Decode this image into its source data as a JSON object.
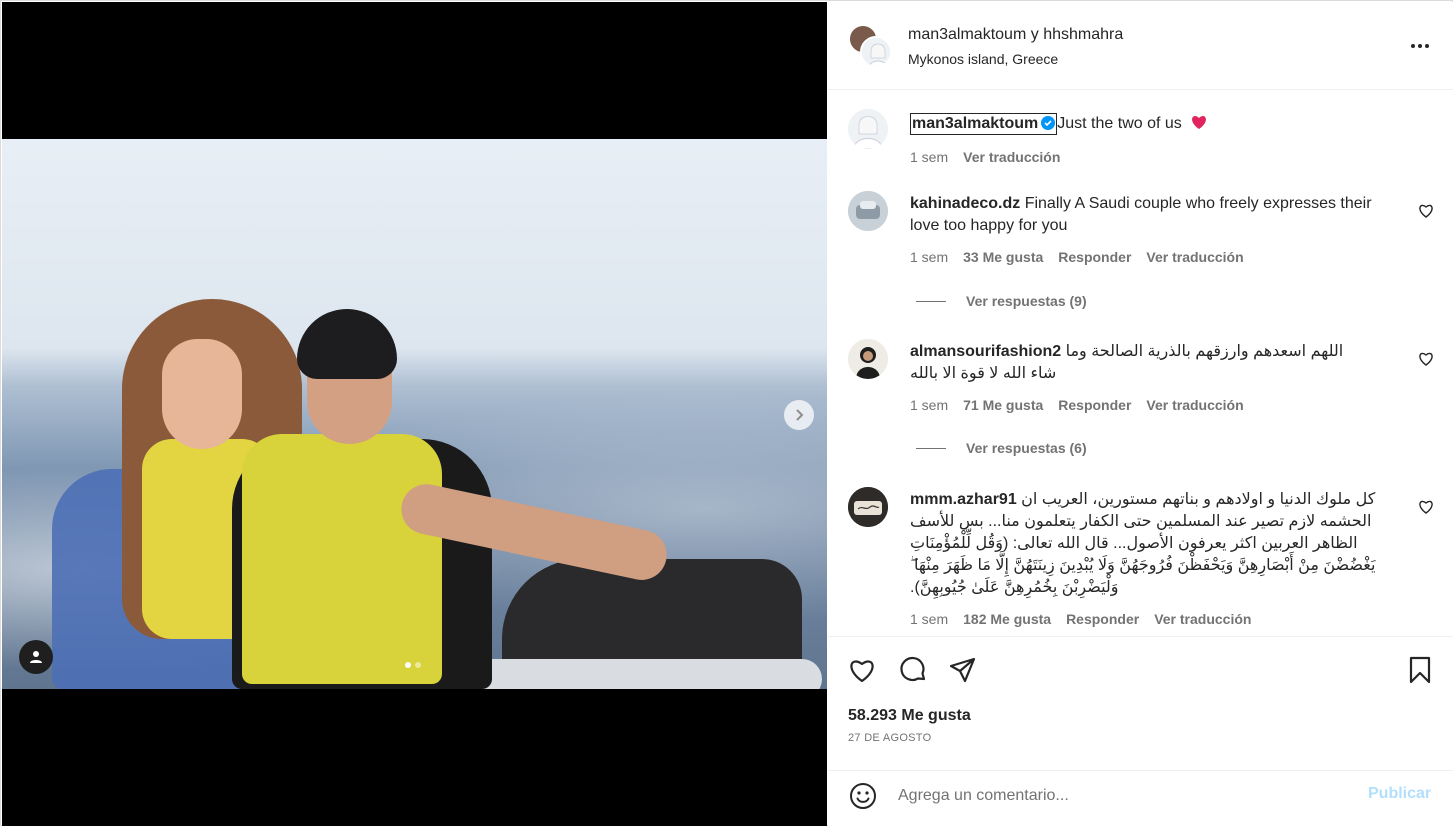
{
  "media": {
    "slide_count": 2,
    "active_slide": 1
  },
  "header": {
    "username1": "man3almaktoum",
    "connector": "y",
    "username2": "hhshmahra",
    "location": "Mykonos island, Greece"
  },
  "caption": {
    "username": "man3almaktoum",
    "text": "Just the two of us",
    "time": "1 sem",
    "translate": "Ver traducción"
  },
  "comments": [
    {
      "username": "kahinadeco.dz",
      "text": "Finally A Saudi couple who freely expresses their love too happy for you",
      "time": "1 sem",
      "likes": "33 Me gusta",
      "reply": "Responder",
      "translate": "Ver traducción",
      "replies": "Ver respuestas (9)"
    },
    {
      "username": "almansourifashion2",
      "text": "اللهم اسعدهم وارزقهم بالذرية الصالحة وما شاء الله لا قوة الا بالله",
      "time": "1 sem",
      "likes": "71 Me gusta",
      "reply": "Responder",
      "translate": "Ver traducción",
      "replies": "Ver respuestas (6)"
    },
    {
      "username": "mmm.azhar91",
      "text": "كل ملوك الدنيا و اولادهم و بناتهم مستورين، العريب ان الحشمه لازم تصير عند المسلمين حتى الكفار يتعلمون منا... بس للأسف الظاهر العربين اكثر يعرفون الأصول... قال الله تعالى: (وَقُل لِّلْمُؤْمِنَاتِ يَغْضُضْنَ مِنْ أَبْصَارِهِنَّ وَيَحْفَظْنَ فُرُوجَهُنَّ وَلَا يُبْدِينَ زِينَتَهُنَّ إِلَّا مَا ظَهَرَ مِنْهَا ۖ وَلْيَضْرِبْنَ بِخُمُرِهِنَّ عَلَىٰ جُيُوبِهِنَّ).",
      "time": "1 sem",
      "likes": "182 Me gusta",
      "reply": "Responder",
      "translate": "Ver traducción"
    }
  ],
  "post": {
    "likes": "58.293 Me gusta",
    "date": "27 DE AGOSTO"
  },
  "add_comment": {
    "placeholder": "Agrega un comentario...",
    "publish": "Publicar"
  },
  "icons": {
    "more": "more-options-icon",
    "verified": "verified-badge-icon",
    "like": "heart-icon",
    "comment": "comment-icon",
    "share": "send-icon",
    "save": "bookmark-icon",
    "emoji": "emoji-icon",
    "next": "chevron-right-icon",
    "user_tags": "user-icon"
  },
  "colors": {
    "verified": "#0095f6",
    "heart_emoji": "#e0245e",
    "publish_disabled": "#b2dffc"
  }
}
